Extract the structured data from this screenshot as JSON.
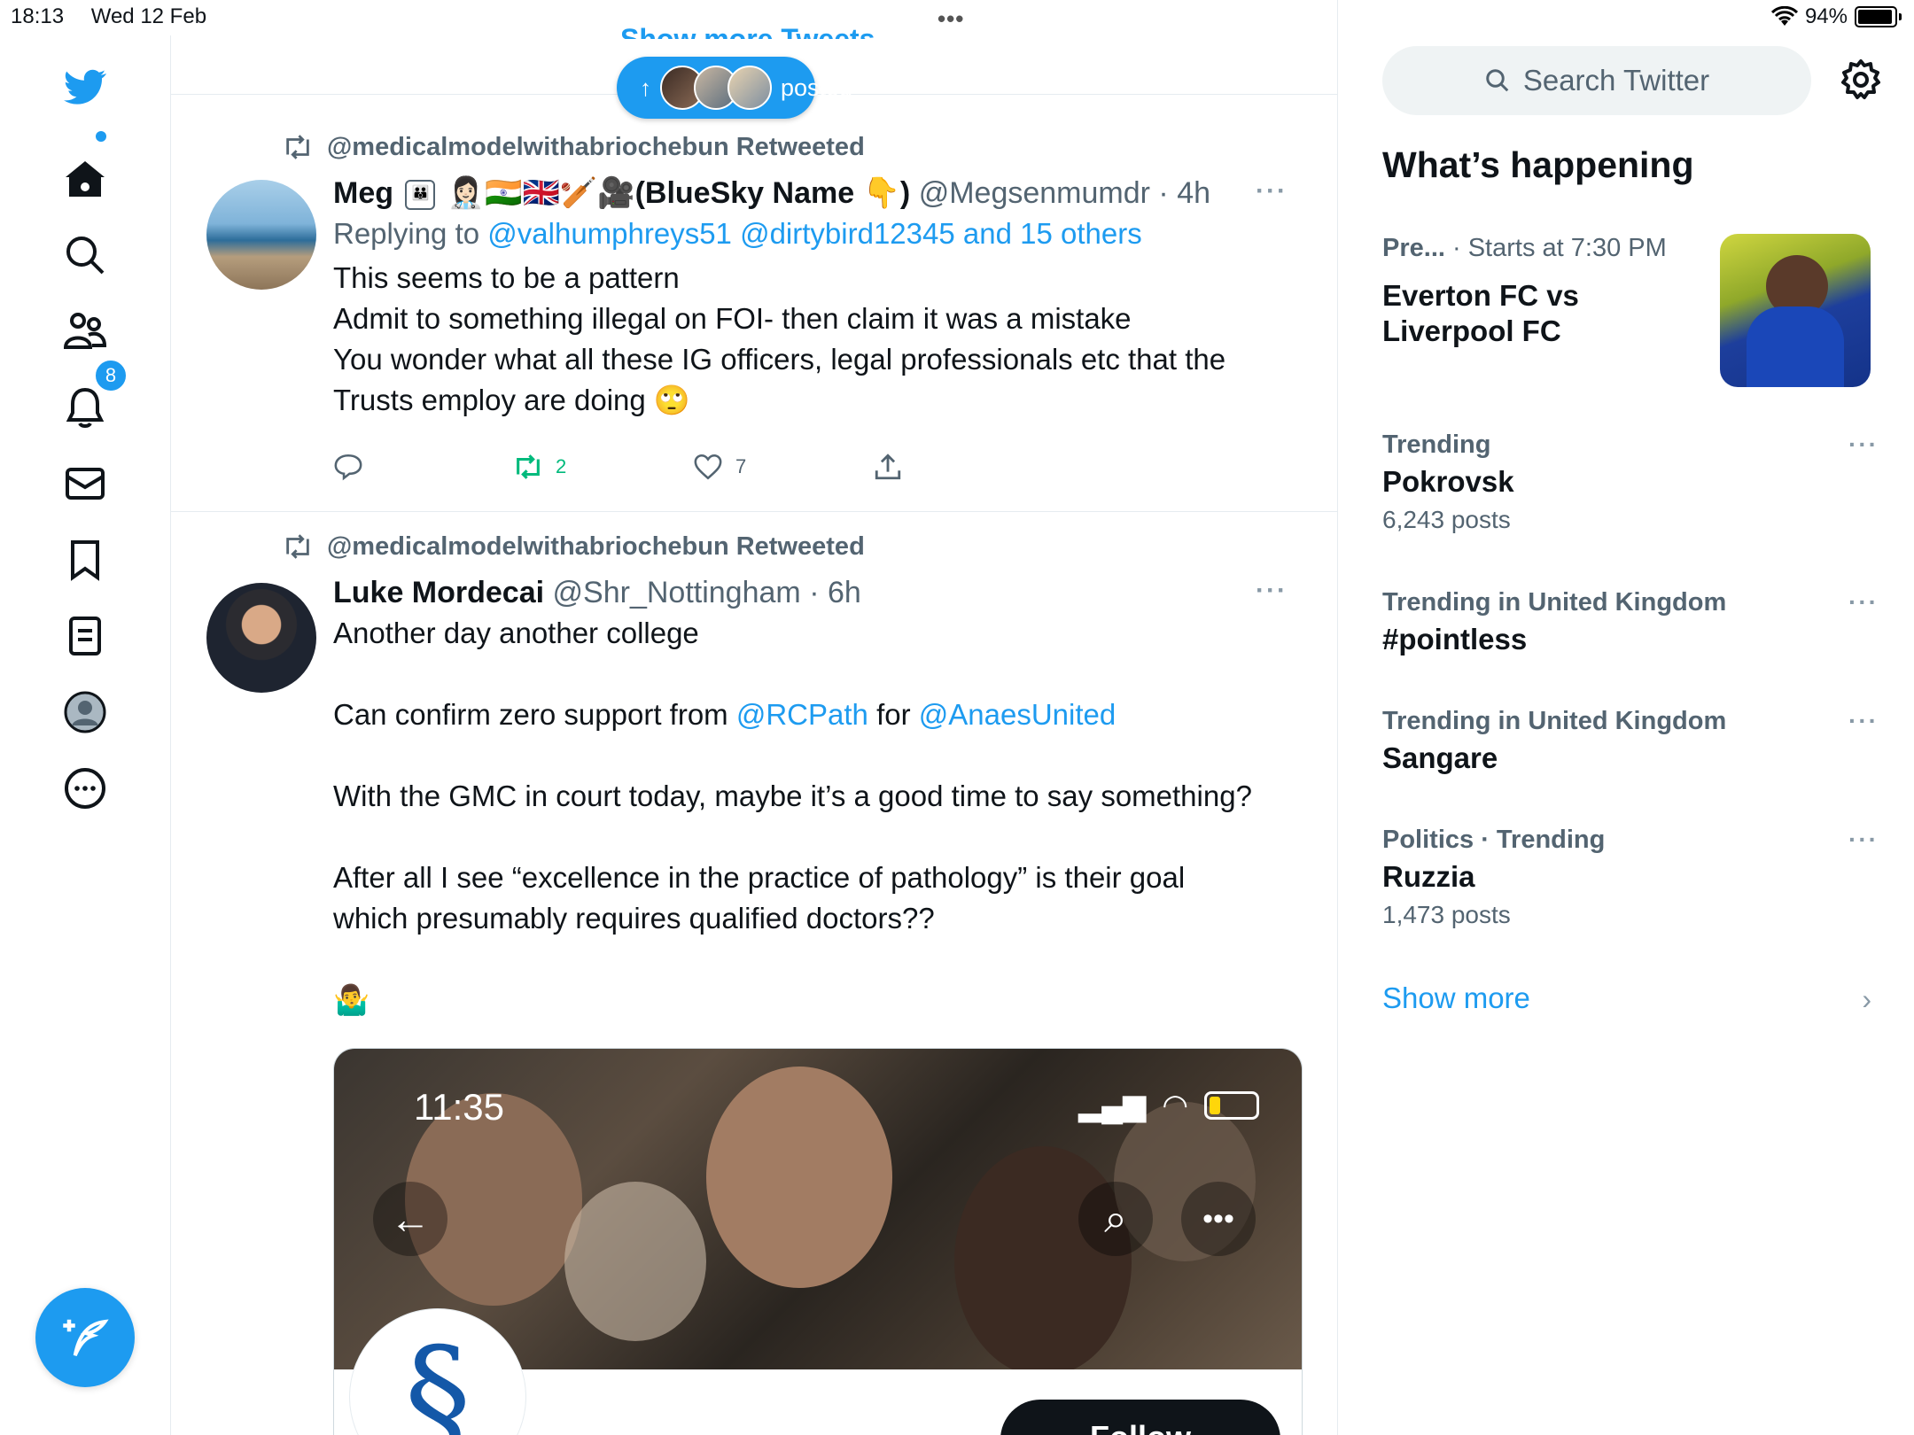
{
  "status_bar": {
    "time": "18:13",
    "date": "Wed 12 Feb",
    "battery": "94%"
  },
  "feed": {
    "show_more_tweets": "Show more Tweets",
    "posted_pill": "posted",
    "tweets": [
      {
        "retweeted_by": "@medicalmodelwithabriochebun Retweeted",
        "name": "Meg",
        "name_suffix": "(BlueSky Name",
        "name_close": ")",
        "handle": "@Megsenmumdr",
        "time": "· 4h",
        "replying_prefix": "Replying to",
        "replying_to": "@valhumphreys51 @dirtybird12345 and 15 others",
        "lines": [
          "This seems to be a pattern",
          "Admit to something illegal on FOI- then claim it was a mistake",
          "You wonder what all these IG officers, legal professionals etc that the",
          "Trusts employ are doing 🙄"
        ],
        "retweets": "2",
        "likes": "7",
        "more": "···"
      },
      {
        "retweeted_by": "@medicalmodelwithabriochebun Retweeted",
        "name": "Luke Mordecai",
        "handle": "@Shr_Nottingham",
        "time": "· 6h",
        "line1": "Another day another college",
        "line2_prefix": "Can confirm zero support from",
        "line2_mention1": "@RCPath",
        "line2_mid": "for",
        "line2_mention2": "@AnaesUnited",
        "line3": "With the GMC in court today, maybe it’s a good time to say something?",
        "line4a": "After all I see “excellence in the practice of pathology” is their goal",
        "line4b": "which presumably requires qualified doctors??",
        "line5": "🤷‍♂️",
        "media_time": "11:35",
        "follow": "Follow",
        "more": "···"
      }
    ]
  },
  "right": {
    "search_placeholder": "Search Twitter",
    "whats_happening": "What’s happening",
    "event": {
      "category": "Pre...",
      "starts": "· Starts at 7:30 PM",
      "title_l1": "Everton FC vs",
      "title_l2": "Liverpool FC"
    },
    "trends": [
      {
        "meta": "Trending",
        "name": "Pokrovsk",
        "count": "6,243 posts"
      },
      {
        "meta": "Trending in United Kingdom",
        "name": "#pointless",
        "count": ""
      },
      {
        "meta": "Trending in United Kingdom",
        "name": "Sangare",
        "count": ""
      },
      {
        "meta": "Politics · Trending",
        "name": "Ruzzia",
        "count": "1,473 posts"
      }
    ],
    "show_more": "Show more"
  },
  "sidebar": {
    "notification_count": "8"
  },
  "colors": {
    "accent": "#1d9bf0",
    "retweet_green": "#00ba7c",
    "muted": "#536471"
  }
}
